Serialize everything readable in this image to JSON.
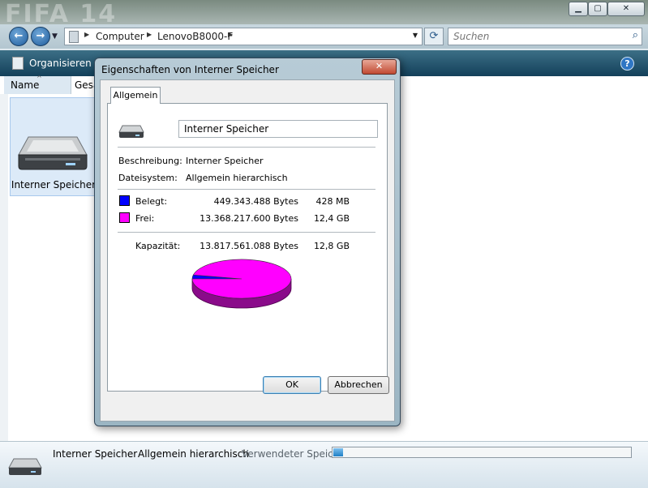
{
  "window": {
    "background_text": "FIFA 14",
    "address": {
      "crumbs": [
        "Computer",
        "LenovoB8000-F"
      ]
    },
    "search_placeholder": "Suchen",
    "toolbar": {
      "organize_label": "Organisieren"
    },
    "columns": {
      "name": "Name",
      "size": "Gesa"
    },
    "items": [
      {
        "label": "Interner Speicher"
      }
    ],
    "details": {
      "title": "Interner Speicher",
      "filesystem": "Allgemein hierarchisch",
      "used_label": "Verwendeter Speic...",
      "used_fraction": 0.0325
    }
  },
  "dialog": {
    "title": "Eigenschaften von Interner Speicher",
    "close_glyph": "✕",
    "tab": "Allgemein",
    "name_value": "Interner Speicher",
    "description_label": "Beschreibung:",
    "description_value": "Interner Speicher",
    "filesystem_label": "Dateisystem:",
    "filesystem_value": "Allgemein hierarchisch",
    "used": {
      "label": "Belegt:",
      "bytes": "449.343.488 Bytes",
      "human": "428 MB",
      "color": "#0000ff"
    },
    "free": {
      "label": "Frei:",
      "bytes": "13.368.217.600 Bytes",
      "human": "12,4 GB",
      "color": "#ff00ff"
    },
    "capacity": {
      "label": "Kapazität:",
      "bytes": "13.817.561.088 Bytes",
      "human": "12,8 GB"
    },
    "ok_label": "OK",
    "cancel_label": "Abbrechen"
  },
  "chart_data": {
    "type": "pie",
    "categories": [
      "Belegt",
      "Frei"
    ],
    "values": [
      449343488,
      13368217600
    ],
    "colors": [
      "#0000ff",
      "#ff00ff"
    ]
  }
}
